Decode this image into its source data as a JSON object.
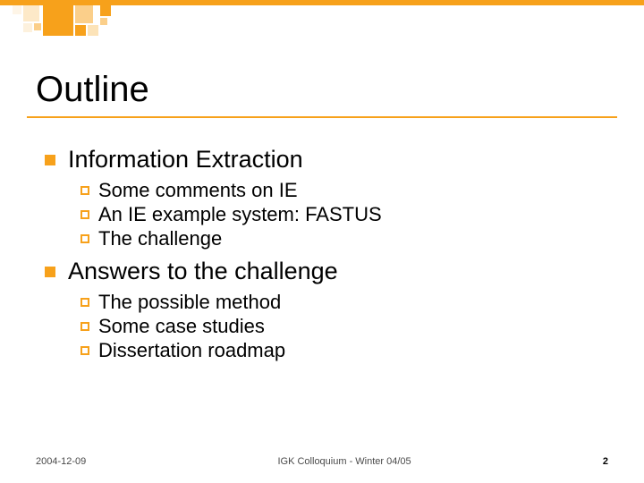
{
  "title": "Outline",
  "sections": [
    {
      "heading": "Information Extraction",
      "items": [
        "Some comments on IE",
        "An IE example system: FASTUS",
        "The challenge"
      ]
    },
    {
      "heading": "Answers to the challenge",
      "items": [
        "The possible method",
        "Some case studies",
        "Dissertation roadmap"
      ]
    }
  ],
  "footer": {
    "date": "2004-12-09",
    "center": "IGK Colloquium - Winter 04/05",
    "page": "2"
  },
  "colors": {
    "accent": "#f7a11b"
  }
}
